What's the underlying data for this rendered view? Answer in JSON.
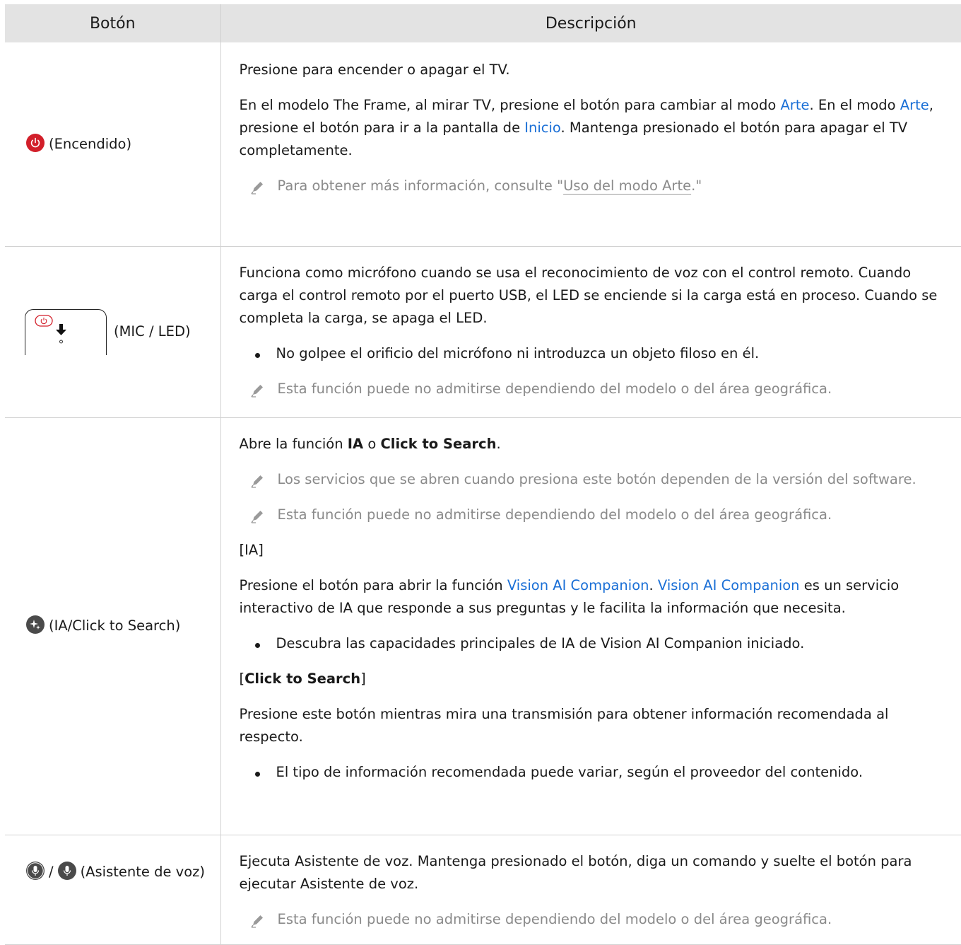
{
  "headers": {
    "col1": "Botón",
    "col2": "Descripción"
  },
  "rows": [
    {
      "button_label": "(Encendido)",
      "p1": "Presione para encender o apagar el TV.",
      "p2": {
        "a": "En el modelo The Frame, al mirar TV, presione el botón para cambiar al modo ",
        "link1": "Arte",
        "b": ". En el modo ",
        "link2": "Arte",
        "c": ", presione el botón para ir a la pantalla de ",
        "link3": "Inicio",
        "d": ". Mantenga presionado el botón para apagar el TV completamente."
      },
      "note": {
        "a": "Para obtener más información, consulte \"",
        "link": "Uso del modo Arte",
        "b": ".\""
      }
    },
    {
      "button_label": "(MIC / LED)",
      "p1": "Funciona como micrófono cuando se usa el reconocimiento de voz con el control remoto. Cuando carga el control remoto por el puerto USB, el LED se enciende si la carga está en proceso. Cuando se completa la carga, se apaga el LED.",
      "bullet1": "No golpee el orificio del micrófono ni introduzca un objeto filoso en él.",
      "note": "Esta función puede no admitirse dependiendo del modelo o del área geográfica."
    },
    {
      "button_label": "(IA/Click to Search)",
      "p1": {
        "a": "Abre la función ",
        "b1": "IA",
        "mid": " o ",
        "b2": "Click to Search",
        "end": "."
      },
      "note1": "Los servicios que se abren cuando presiona este botón dependen de la versión del software.",
      "note2": "Esta función puede no admitirse dependiendo del modelo o del área geográfica.",
      "heading_ia": "[IA]",
      "p2": {
        "a": "Presione el botón para abrir la función ",
        "link1": "Vision AI Companion",
        "b": ". ",
        "link2": "Vision AI Companion",
        "c": " es un servicio interactivo de IA que responde a sus preguntas y le facilita la información que necesita."
      },
      "bullet1": "Descubra las capacidades principales de IA de Vision AI Companion iniciado.",
      "heading_cts": {
        "open": "[",
        "bold": "Click to Search",
        "close": "]"
      },
      "p3": "Presione este botón mientras mira una transmisión para obtener información recomendada al respecto.",
      "bullet2": "El tipo de información recomendada puede variar, según el proveedor del contenido."
    },
    {
      "button_sep": "/",
      "button_label": "(Asistente de voz)",
      "p1": "Ejecuta Asistente de voz. Mantenga presionado el botón, diga un comando y suelte el botón para ejecutar Asistente de voz.",
      "note": "Esta función puede no admitirse dependiendo del modelo o del área geográfica."
    }
  ],
  "colors": {
    "link": "#1a6fd6",
    "note": "#8a8a8a",
    "header_bg": "#e3e3e3",
    "power_red": "#d21f2a",
    "icon_dark": "#4a4a4a"
  }
}
